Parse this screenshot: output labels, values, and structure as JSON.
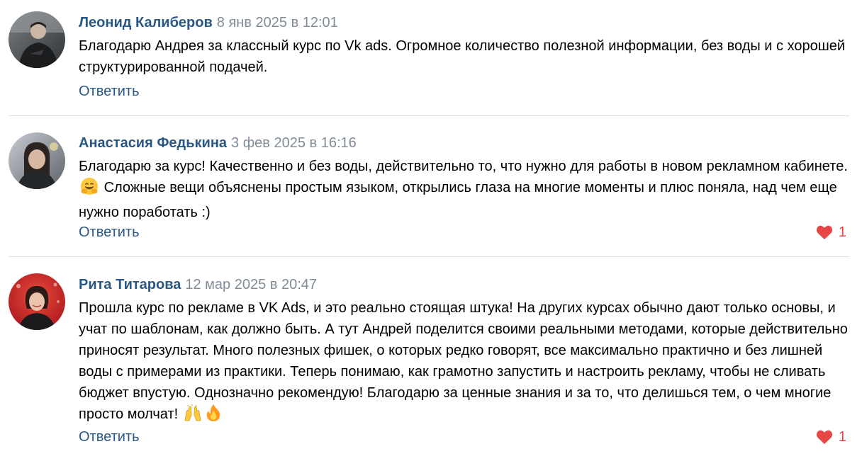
{
  "comments": [
    {
      "author": "Леонид Калиберов",
      "date": "8 янв 2025 в 12:01",
      "text": "Благодарю Андрея за классный курс по Vk ads. Огромное количество полезной информации, без воды и с хорошей структурированной подачей.",
      "reply_label": "Ответить",
      "avatar_icon": "user-photo-avatar",
      "likes": null
    },
    {
      "author": "Анастасия Федькина",
      "date": "3 фев 2025 в 16:16",
      "text_before_emoji": "Благодарю за курс! Качественно и без воды, действительно то, что нужно для работы в новом рекламном кабинете.",
      "emoji": "hugging-face-emoji",
      "text_after_emoji": "Сложные вещи объяснены простым языком, открылись глаза на многие моменты и плюс поняла, над чем еще нужно поработать :)",
      "reply_label": "Ответить",
      "avatar_icon": "user-photo-avatar",
      "likes": "1"
    },
    {
      "author": "Рита Титарова",
      "date": "12 мар 2025 в 20:47",
      "text": "Прошла курс по рекламе в VK Ads, и это реально стоящая штука! На других курсах обычно дают только основы, и учат по шаблонам, как должно быть. А тут Андрей поделится своими реальными методами, которые действительно приносят результат. Много полезных фишек, о которых редко говорят, все максимально практично и без лишней воды с примерами из практики. Теперь понимаю, как грамотно запустить и настроить рекламу, чтобы не сливать бюджет впустую. Однозначно рекомендую! Благодарю за ценные знания и за то, что делишься тем, о чем многие просто молчат!",
      "emojis": [
        "raising-hands-emoji",
        "fire-emoji"
      ],
      "reply_label": "Ответить",
      "avatar_icon": "user-photo-avatar",
      "likes": "1"
    }
  ],
  "colors": {
    "author": "#2a5885",
    "date": "#818c99",
    "link": "#2a5885",
    "like": "#e64646",
    "divider": "#dce1e6"
  }
}
